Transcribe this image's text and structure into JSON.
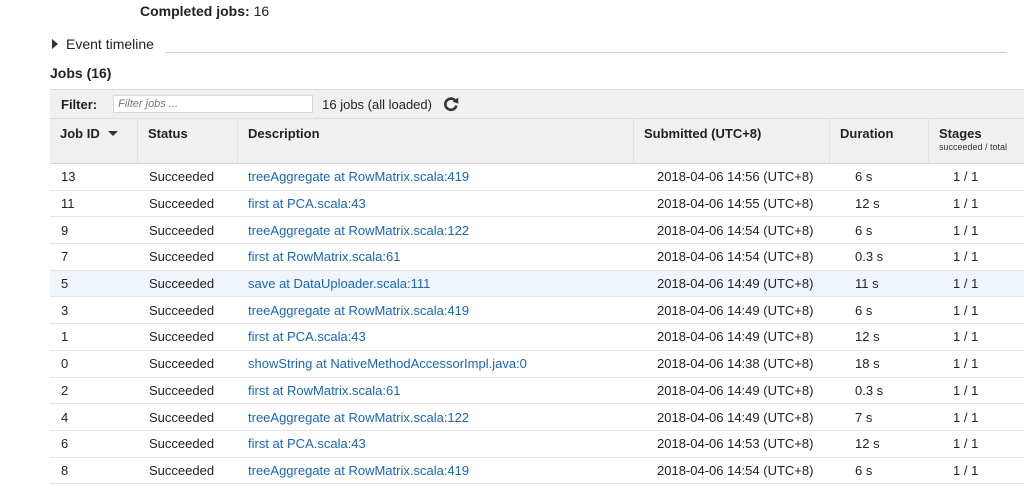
{
  "summary": {
    "completed_label": "Completed jobs:",
    "completed_value": "16"
  },
  "event_timeline": {
    "label": "Event timeline"
  },
  "jobs_heading": "Jobs (16)",
  "filter": {
    "label": "Filter:",
    "placeholder": "Filter jobs ...",
    "count_text": "16 jobs (all loaded)"
  },
  "columns": {
    "job_id": "Job ID",
    "status": "Status",
    "description": "Description",
    "submitted": "Submitted (UTC+8)",
    "duration": "Duration",
    "stages": "Stages",
    "stages_sub": "succeeded / total"
  },
  "rows": [
    {
      "id": "13",
      "status": "Succeeded",
      "description": "treeAggregate at RowMatrix.scala:419",
      "submitted": "2018-04-06 14:56 (UTC+8)",
      "duration": "6 s",
      "stages": "1 / 1"
    },
    {
      "id": "11",
      "status": "Succeeded",
      "description": "first at PCA.scala:43",
      "submitted": "2018-04-06 14:55 (UTC+8)",
      "duration": "12 s",
      "stages": "1 / 1"
    },
    {
      "id": "9",
      "status": "Succeeded",
      "description": "treeAggregate at RowMatrix.scala:122",
      "submitted": "2018-04-06 14:54 (UTC+8)",
      "duration": "6 s",
      "stages": "1 / 1"
    },
    {
      "id": "7",
      "status": "Succeeded",
      "description": "first at RowMatrix.scala:61",
      "submitted": "2018-04-06 14:54 (UTC+8)",
      "duration": "0.3 s",
      "stages": "1 / 1"
    },
    {
      "id": "5",
      "status": "Succeeded",
      "description": "save at DataUploader.scala:111",
      "submitted": "2018-04-06 14:49 (UTC+8)",
      "duration": "11 s",
      "stages": "1 / 1"
    },
    {
      "id": "3",
      "status": "Succeeded",
      "description": "treeAggregate at RowMatrix.scala:419",
      "submitted": "2018-04-06 14:49 (UTC+8)",
      "duration": "6 s",
      "stages": "1 / 1"
    },
    {
      "id": "1",
      "status": "Succeeded",
      "description": "first at PCA.scala:43",
      "submitted": "2018-04-06 14:49 (UTC+8)",
      "duration": "12 s",
      "stages": "1 / 1"
    },
    {
      "id": "0",
      "status": "Succeeded",
      "description": "showString at NativeMethodAccessorImpl.java:0",
      "submitted": "2018-04-06 14:38 (UTC+8)",
      "duration": "18 s",
      "stages": "1 / 1"
    },
    {
      "id": "2",
      "status": "Succeeded",
      "description": "first at RowMatrix.scala:61",
      "submitted": "2018-04-06 14:49 (UTC+8)",
      "duration": "0.3 s",
      "stages": "1 / 1"
    },
    {
      "id": "4",
      "status": "Succeeded",
      "description": "treeAggregate at RowMatrix.scala:122",
      "submitted": "2018-04-06 14:49 (UTC+8)",
      "duration": "7 s",
      "stages": "1 / 1"
    },
    {
      "id": "6",
      "status": "Succeeded",
      "description": "first at PCA.scala:43",
      "submitted": "2018-04-06 14:53 (UTC+8)",
      "duration": "12 s",
      "stages": "1 / 1"
    },
    {
      "id": "8",
      "status": "Succeeded",
      "description": "treeAggregate at RowMatrix.scala:419",
      "submitted": "2018-04-06 14:54 (UTC+8)",
      "duration": "6 s",
      "stages": "1 / 1"
    }
  ],
  "colors": {
    "link": "#1a66b5",
    "highlight_row": "#f0f5fb",
    "header_bg": "#f0f0f0"
  },
  "icons": {
    "refresh": "refresh-icon",
    "timeline_toggle": "triangle-right-icon",
    "sort": "sort-down-icon"
  }
}
